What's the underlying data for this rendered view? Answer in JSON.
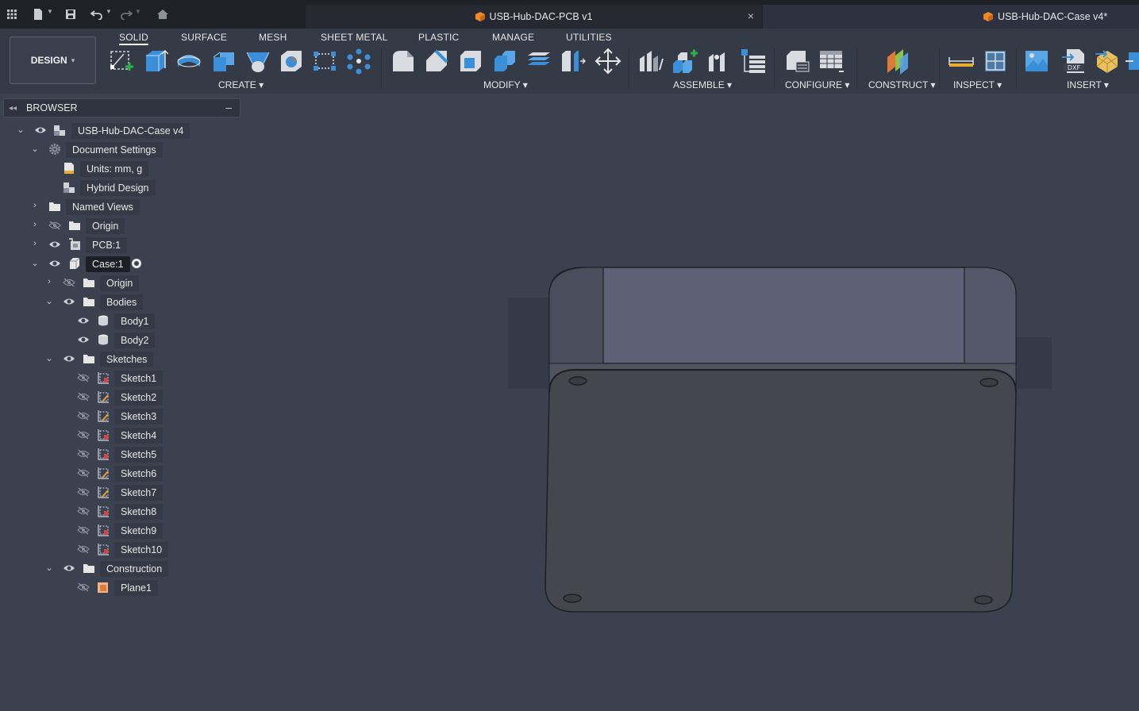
{
  "tabs": [
    {
      "label": "USB-Hub-DAC-PCB v1",
      "close": "×"
    },
    {
      "label": "USB-Hub-DAC-Case v4*"
    }
  ],
  "workspace": {
    "label": "DESIGN",
    "caret": "▾"
  },
  "toolbar_tabs": [
    "SOLID",
    "SURFACE",
    "MESH",
    "SHEET METAL",
    "PLASTIC",
    "MANAGE",
    "UTILITIES"
  ],
  "groups": {
    "create": "CREATE ▾",
    "modify": "MODIFY ▾",
    "assemble": "ASSEMBLE ▾",
    "configure": "CONFIGURE ▾",
    "construct": "CONSTRUCT ▾",
    "inspect": "INSPECT ▾",
    "insert": "INSERT ▾"
  },
  "browser": {
    "title": "BROWSER",
    "collapse": "◂◂",
    "minimize": "–",
    "rows": [
      {
        "label": "USB-Hub-DAC-Case v4"
      },
      {
        "label": "Document Settings"
      },
      {
        "label": "Units: mm, g"
      },
      {
        "label": "Hybrid Design"
      },
      {
        "label": "Named Views"
      },
      {
        "label": "Origin"
      },
      {
        "label": "PCB:1"
      },
      {
        "label": "Case:1"
      },
      {
        "label": "Origin"
      },
      {
        "label": "Bodies"
      },
      {
        "label": "Body1"
      },
      {
        "label": "Body2"
      },
      {
        "label": "Sketches"
      },
      {
        "label": "Sketch1"
      },
      {
        "label": "Sketch2"
      },
      {
        "label": "Sketch3"
      },
      {
        "label": "Sketch4"
      },
      {
        "label": "Sketch5"
      },
      {
        "label": "Sketch6"
      },
      {
        "label": "Sketch7"
      },
      {
        "label": "Sketch8"
      },
      {
        "label": "Sketch9"
      },
      {
        "label": "Sketch10"
      },
      {
        "label": "Construction"
      },
      {
        "label": "Plane1"
      }
    ]
  },
  "colors": {
    "background": "#3c4150",
    "toolbar": "#353a47",
    "titlebar": "#1f2128",
    "tool_blue": "#3b8fd9",
    "case_dark": "#44474f",
    "case_top": "#5c6175",
    "sketch_red": "#d04545",
    "plane_orange": "#e08a55"
  },
  "icons": [
    "app-grid-icon",
    "file-icon",
    "save-icon",
    "undo-icon",
    "redo-icon",
    "home-icon",
    "eye-icon",
    "eye-hidden-icon",
    "folder-icon",
    "gear-icon",
    "sketch-icon",
    "body-icon",
    "component-icon",
    "plane-icon"
  ]
}
